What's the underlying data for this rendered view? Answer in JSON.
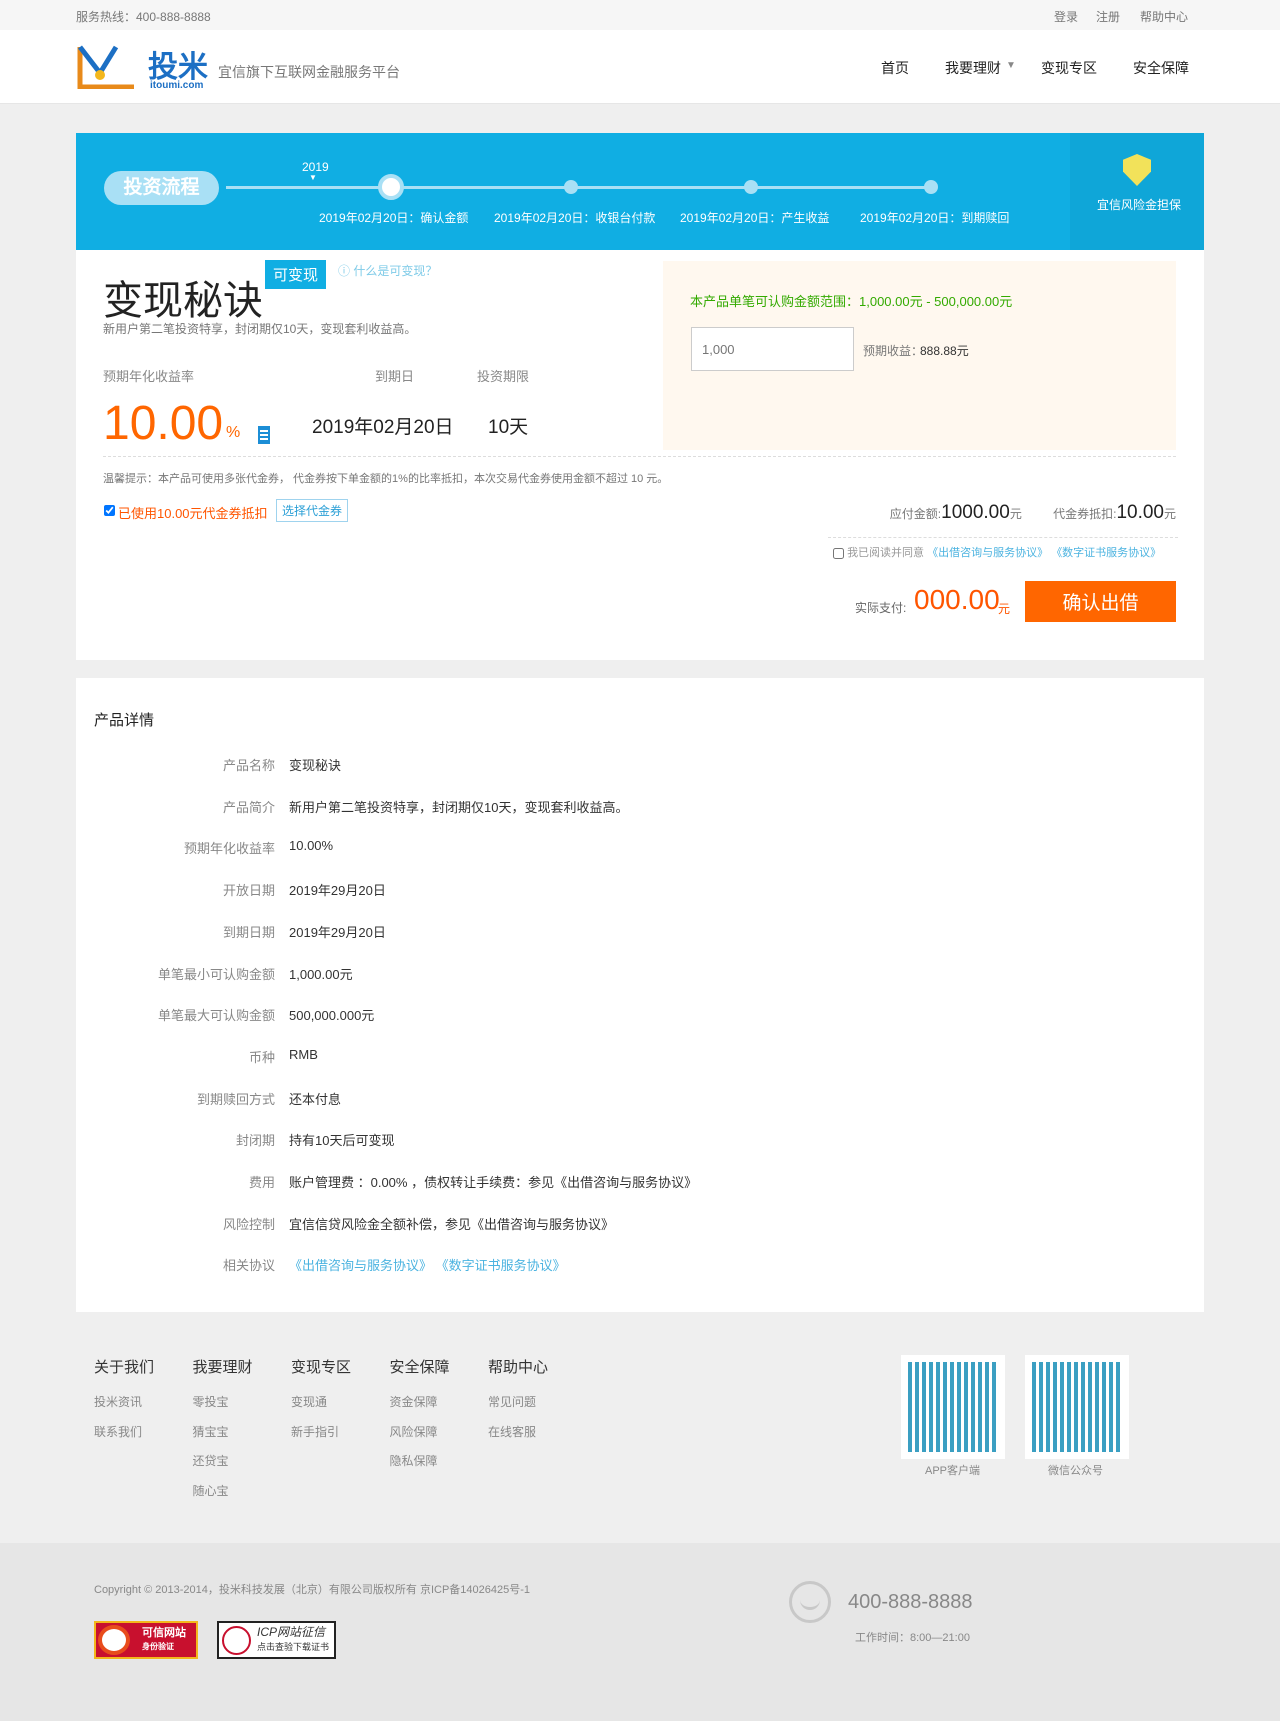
{
  "topbar": {
    "hotline": "服务热线：400-888-8888",
    "links": [
      "登录",
      "注册",
      "帮助中心"
    ]
  },
  "header": {
    "logo_text": "投米",
    "logo_domain": "itoumi.com",
    "slogan": "宜信旗下互联网金融服务平台",
    "nav": [
      "首页",
      "我要理财",
      "变现专区",
      "安全保障"
    ]
  },
  "banner": {
    "label": "投资流程",
    "year": "2019",
    "steps": [
      "2019年02月20日：确认金额",
      "2019年02月20日：收银台付款",
      "2019年02月20日：产生收益",
      "2019年02月20日：到期赎回"
    ],
    "guarantee": "宜信风险金担保"
  },
  "product": {
    "name": "变现秘诀",
    "tag": "可变现",
    "help": "什么是可变现？",
    "desc": "新用户第二笔投资特享，封闭期仅10天，变现套利收益高。",
    "rate_label": "预期年化收益率",
    "rate": "10.00",
    "rate_unit": "%",
    "due_label": "到期日",
    "due": "2019年02月20日",
    "term_label": "投资期限",
    "term": "10天"
  },
  "purchase": {
    "range": "本产品单笔可认购金额范围：1,000.00元 - 500,000.00元",
    "amount_placeholder": "1,000",
    "expected_label": "预期收益：",
    "expected": "888.88元"
  },
  "tip": "温馨提示：本产品可使用多张代金券， 代金券按下单金额的1%的比率抵扣，本次交易代金券使用金额不超过 10 元。",
  "voucher": {
    "used": "已使用10.00元代金券抵扣",
    "select": "选择代金券"
  },
  "payment": {
    "payable_label": "应付金额:",
    "payable": "1000.00",
    "voucher_label": "代金券抵扣:",
    "voucher": "10.00",
    "unit": "元",
    "agree": "我已阅读并同意",
    "agreement1": "《出借咨询与服务协议》",
    "agreement2": "《数字证书服务协议》",
    "actual_label": "实际支付:",
    "actual": "000.00",
    "confirm": "确认出借"
  },
  "details": {
    "title": "产品详情",
    "rows": [
      {
        "label": "产品名称",
        "value": "变现秘诀"
      },
      {
        "label": "产品简介",
        "value": "新用户第二笔投资特享，封闭期仅10天，变现套利收益高。"
      },
      {
        "label": "预期年化收益率",
        "value": "10.00%"
      },
      {
        "label": "开放日期",
        "value": "2019年29月20日"
      },
      {
        "label": "到期日期",
        "value": "2019年29月20日"
      },
      {
        "label": "单笔最小可认购金额",
        "value": "1,000.00元"
      },
      {
        "label": "单笔最大可认购金额",
        "value": "500,000.000元"
      },
      {
        "label": "币种",
        "value": "RMB"
      },
      {
        "label": "到期赎回方式",
        "value": "还本付息"
      },
      {
        "label": "封闭期",
        "value": "持有10天后可变现"
      },
      {
        "label": "费用",
        "value": "账户管理费 ：0.00% ，债权转让手续费：参见《出借咨询与服务协议》"
      },
      {
        "label": "风险控制",
        "value": "宜信信贷风险金全额补偿，参见《出借咨询与服务协议》"
      },
      {
        "label": "相关协议",
        "value": "",
        "links": [
          "《出借咨询与服务协议》",
          "《数字证书服务协议》"
        ]
      }
    ]
  },
  "footer": {
    "columns": [
      {
        "title": "关于我们",
        "items": [
          "投米资讯",
          "联系我们"
        ]
      },
      {
        "title": "我要理财",
        "items": [
          "零投宝",
          "猜宝宝",
          "还贷宝",
          "随心宝"
        ]
      },
      {
        "title": "变现专区",
        "items": [
          "变现通",
          "新手指引"
        ]
      },
      {
        "title": "安全保障",
        "items": [
          "资金保障",
          "风险保障",
          "隐私保障"
        ]
      },
      {
        "title": "帮助中心",
        "items": [
          "常见问题",
          "在线客服"
        ]
      }
    ],
    "qr": [
      "APP客户端",
      "微信公众号"
    ],
    "copyright": "Copyright © 2013-2014，投米科技发展（北京）有限公司版权所有 京ICP备14026425号-1",
    "phone": "400-888-8888",
    "hours": "工作时间：8:00—21:00",
    "badges": [
      "可信网站",
      "身份验证",
      "ICP网站征信",
      "点击查验下载证书"
    ]
  },
  "colors": {
    "blue": "#10aee3",
    "orange": "#ff6600",
    "green": "#33aa00"
  }
}
